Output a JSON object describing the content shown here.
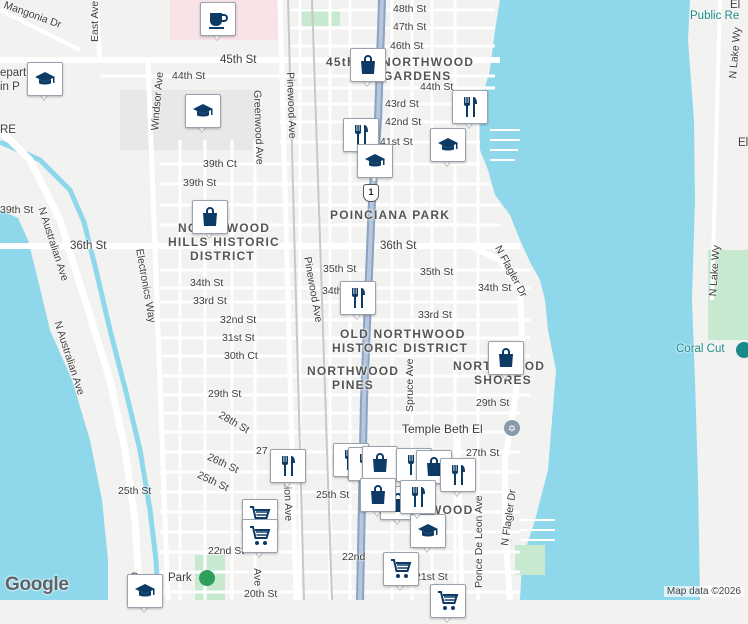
{
  "map": {
    "attribution": "Map data ©2026",
    "logo": "Google",
    "highway_shield": "1",
    "colors": {
      "water": "#8fd8ec",
      "land": "#f2f2f0",
      "park": "#c6e9cf",
      "road": "#ffffff",
      "major_road": "#8aa3c4",
      "poi_icon": "#0d3b66",
      "teal_label": "#1a8a8a"
    }
  },
  "labels": {
    "st_48": "48th St",
    "st_47": "47th St",
    "st_46": "46th St",
    "st_45_west": "45th St",
    "st_45_east": "45th St",
    "st_44_west": "44th St",
    "st_44_east": "44th St",
    "st_43": "43rd St",
    "st_42": "42nd St",
    "st_41": "41st St",
    "ct_39": "39th Ct",
    "st_39_a": "39th St",
    "st_39_b": "39th St",
    "st_36_west": "36th St",
    "st_36_mid": "36th St",
    "st_35_a": "35th St",
    "st_35_b": "35th St",
    "st_34_a": "34th St",
    "st_34_b": "34th",
    "st_34_c": "34th St",
    "st_33_a": "33rd St",
    "st_33_b": "33rd St",
    "st_32": "32nd St",
    "st_31": "31st St",
    "ct_30": "30th Ct",
    "st_29_a": "29th St",
    "st_29_b": "29th St",
    "st_28": "28th St",
    "st_27_a": "27",
    "st_27_b": "27th St",
    "st_26": "26th St",
    "st_25_a": "25th St",
    "st_25_b": "25th St",
    "st_25_c": "25th St",
    "st_22": "22nd St",
    "st_22_b": "22nd",
    "st_21": "21st St",
    "st_20": "20th St",
    "mangonia": "Mangonia Dr",
    "east_ave": "East Ave",
    "windsor": "Windsor Ave",
    "greenwood": "Greenwood Ave",
    "pinewood_n": "Pinewood Ave",
    "pinewood_s": "Pinewood Ave",
    "electronics": "Electronics Way",
    "n_australian_1": "N Australian Ave",
    "n_australian_2": "N Australian Ave",
    "spruce": "Spruce Ave",
    "de_leon": "Ponce De Leon Ave",
    "n_flagler_top": "N Flagler Dr",
    "n_flagler_bottom": "N Flagler Dr",
    "lake_way_top": "N Lake Wy",
    "lake_way_mid": "N Lake Wy",
    "lake_ave": "...ion Ave",
    "lake_ave2": "Ave",
    "partial_re": "RE",
    "partial_depart": "epart",
    "partial_in": "in P",
    "public_library": "Public Re",
    "public_library_top": "El",
    "el_label": "El",
    "coral_cut": "Coral Cut",
    "temple": "Temple Beth El",
    "col_park": "Co",
    "col_park2": "Park",
    "hood_northwood_gardens_1": "45th",
    "hood_northwood_gardens_2": "NORTHWOOD",
    "hood_northwood_gardens_3": "GARDENS",
    "hood_poinciana": "POINCIANA PARK",
    "hood_nhh_1": "NORTHWOOD",
    "hood_nhh_2": "HILLS HISTORIC",
    "hood_nhh_3": "DISTRICT",
    "hood_onh_1": "OLD NORTHWOOD",
    "hood_onh_2": "HISTORIC DISTRICT",
    "hood_np_1": "NORTHWOOD",
    "hood_np_2": "PINES",
    "hood_ns_1": "NORTHWOOD",
    "hood_ns_2": "SHORES",
    "hood_wood": "WOOD"
  },
  "pois": [
    {
      "name": "coffee",
      "icon": "coffee-icon"
    },
    {
      "name": "school-west",
      "icon": "school-icon"
    },
    {
      "name": "school-mid",
      "icon": "school-icon"
    },
    {
      "name": "shopping-north",
      "icon": "shopping-bag-icon"
    },
    {
      "name": "restaurant-42nd",
      "icon": "restaurant-icon"
    },
    {
      "name": "restaurant-43rd",
      "icon": "restaurant-icon"
    },
    {
      "name": "school-41st",
      "icon": "school-icon"
    },
    {
      "name": "school-east",
      "icon": "school-icon"
    },
    {
      "name": "shopping-hills",
      "icon": "shopping-bag-icon"
    },
    {
      "name": "restaurant-34th",
      "icon": "restaurant-icon"
    },
    {
      "name": "shopping-shores",
      "icon": "shopping-bag-icon"
    },
    {
      "name": "restaurant-26th",
      "icon": "restaurant-icon"
    },
    {
      "name": "grocery-24th",
      "icon": "cart-icon"
    },
    {
      "name": "grocery-22nd",
      "icon": "cart-icon"
    },
    {
      "name": "school-south-west",
      "icon": "school-icon"
    },
    {
      "name": "cluster-restaurants",
      "icon": "restaurant-icon"
    },
    {
      "name": "cluster-shopping",
      "icon": "shopping-bag-icon"
    },
    {
      "name": "school-south",
      "icon": "school-icon"
    },
    {
      "name": "grocery-21st",
      "icon": "cart-icon"
    },
    {
      "name": "grocery-south",
      "icon": "cart-icon"
    }
  ]
}
